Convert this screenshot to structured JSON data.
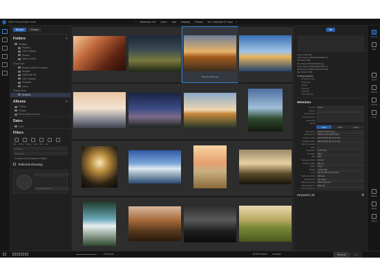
{
  "app": {
    "title": "ON1 Photo RAW 2020",
    "breadcrumb": [
      "Macintosh HD",
      "Users",
      "wolf",
      "Desktop",
      "Photos",
      "D1 1 Selected 21 Total"
    ]
  },
  "left_panel": {
    "tabs": [
      {
        "label": "Browse",
        "active": true
      },
      {
        "label": "Presets",
        "active": false
      }
    ],
    "folders": {
      "title": "Folders",
      "rows": [
        {
          "label": "Desktop",
          "sub": false,
          "highlight": false
        },
        {
          "label": "Pictures",
          "sub": true,
          "highlight": false
        },
        {
          "label": "ON1 Football",
          "sub": true,
          "highlight": false
        },
        {
          "label": "Photos",
          "sub": true,
          "highlight": false
        },
        {
          "label": "Nature (2019)",
          "sub": true,
          "highlight": false
        }
      ],
      "cloud_heading": "Cloud Sync",
      "cloud_rows": [
        {
          "label": "Dropbox (Wolfe Emporer)",
          "highlight": false
        },
        {
          "label": "Recipes",
          "highlight": false
        },
        {
          "label": "Macintosh HD",
          "highlight": false
        },
        {
          "label": "ON1 Football",
          "highlight": false
        },
        {
          "label": "Products",
          "highlight": false
        },
        {
          "label": "Users",
          "highlight": false
        }
      ],
      "shared_heading": "Shared Drive",
      "shared_rows": [
        {
          "label": "Dropbox",
          "highlight": true
        }
      ]
    },
    "albums": {
      "title": "Albums",
      "rows": [
        {
          "label": "4 Stars"
        },
        {
          "label": "5 Stars"
        },
        {
          "label": "Photo Artist Cool Aut..."
        }
      ]
    },
    "dates": {
      "title": "Dates",
      "rows": [
        {
          "label": "2019"
        }
      ]
    },
    "filters": {
      "title": "Filters",
      "labels": [
        "Like",
        "Dislike",
        "Rating",
        "Label",
        "Date",
        "File"
      ],
      "field_1": "All Items",
      "field_2": "Exposure",
      "extra": "Cooltone Extra Camera Profiles"
    },
    "tether": {
      "title": "Tethered Shooting",
      "field_1": "",
      "field_2": "Camera Settings"
    }
  },
  "browser": {
    "selected_caption": "DSC07478-EX.jpg"
  },
  "bottom_bar": {
    "filter_label": "File Name",
    "preview_label": "RGB Previews",
    "preview_value": "Accurate",
    "reset_label": "Reset All",
    "sync_label": "Sync"
  },
  "right_panel": {
    "tab": "Info",
    "file_info": [
      "Sony ILCE-7M3",
      "Color Space sRGB IEC61966-2.1",
      "ISO 100   1/160",
      "File Name DSC07478-EX.jpg",
      "Color Space sRGB IEC61966-2.1",
      "Dimensions 5584x3723 (20.8 MP)",
      "File Size 8.2 MB"
    ],
    "settings_title": "Settings Applied",
    "settings_rows": [
      "Exposure Stat",
      "Exposure",
      "Adjust",
      "Sharpen",
      "Vignette",
      "Local Adjust"
    ],
    "metadata": {
      "title": "Metadata",
      "preset_label": "Preset",
      "preset_value": "None",
      "fields": [
        {
          "k": "Author",
          "v": ""
        },
        {
          "k": "Description",
          "v": ""
        },
        {
          "k": "Add Keyword",
          "v": ""
        },
        {
          "k": "Keywords",
          "v": ""
        }
      ],
      "show_label": "Show",
      "tabs": [
        {
          "label": "Less",
          "active": true
        },
        {
          "label": "IPTC",
          "active": false
        },
        {
          "label": "None",
          "active": false
        }
      ],
      "rows": [
        {
          "k": "File Name",
          "v": "DSC07478-EX.jpg"
        },
        {
          "k": "Dimensions",
          "v": "5584 x 3723 (20.8 MP)"
        },
        {
          "k": "Capture Date",
          "v": "04/21/2019 05:41:11 AM"
        },
        {
          "k": "Modified Date",
          "v": "04/21/2019 05:41:11 AM"
        },
        {
          "k": "User Comment",
          "v": ""
        },
        {
          "k": "GPS",
          "v": ""
        },
        {
          "k": "Exposure",
          "v": "1/160 sec"
        },
        {
          "k": "Aperture",
          "v": "f/8.0"
        },
        {
          "k": "ISO",
          "v": "100"
        },
        {
          "k": "Exposure Bias",
          "v": "0.0 EV"
        },
        {
          "k": "Focal Length",
          "v": "28 mm"
        },
        {
          "k": "Make",
          "v": "Sony"
        },
        {
          "k": "Model",
          "v": "ILCE-7M3"
        },
        {
          "k": "Lens",
          "v": "FE 16-35mm F2.8 GM"
        },
        {
          "k": "Exposure Prog",
          "v": "Manual"
        },
        {
          "k": "Flash Mode",
          "v": "No Flash"
        },
        {
          "k": "Metering Mode",
          "v": "Multi Segment"
        },
        {
          "k": "White Balance",
          "v": "Manual"
        },
        {
          "k": "Focus Distance",
          "v": ""
        }
      ]
    },
    "keyword_list": {
      "title": "Keyword List"
    }
  },
  "tool_rail": [
    {
      "label": "Browse",
      "active": true
    },
    {
      "label": "Edit",
      "active": false
    },
    {
      "label": "Layers",
      "active": false
    },
    {
      "label": "Effects",
      "active": false
    },
    {
      "label": "Portrait",
      "active": false
    },
    {
      "label": "Local",
      "active": false
    },
    {
      "label": "Resize",
      "active": false
    },
    {
      "label": "Share",
      "active": false
    },
    {
      "label": "Export",
      "active": false
    }
  ],
  "thumb_colors": {
    "selection": "#3b86e0"
  }
}
